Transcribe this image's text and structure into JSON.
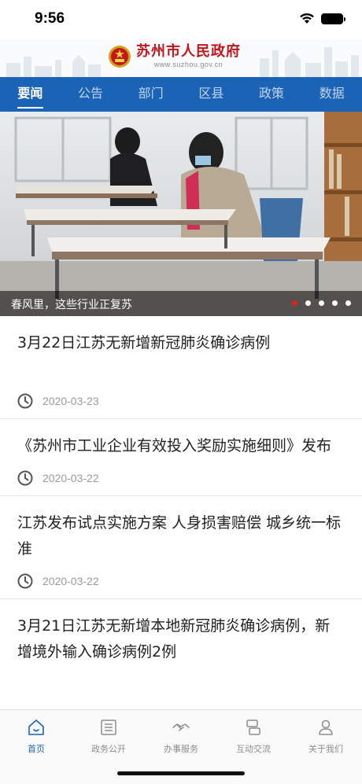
{
  "status_bar": {
    "time": "9:56",
    "icons": [
      "wifi-icon",
      "battery-icon"
    ]
  },
  "header": {
    "title": "苏州市人民政府",
    "url": "www.suzhou.gov.cn",
    "emblem": "national-emblem-icon"
  },
  "tabs": [
    {
      "label": "要闻",
      "active": true
    },
    {
      "label": "公告",
      "active": false
    },
    {
      "label": "部门",
      "active": false
    },
    {
      "label": "区县",
      "active": false
    },
    {
      "label": "政策",
      "active": false
    },
    {
      "label": "数据",
      "active": false
    }
  ],
  "banner": {
    "caption": "春风里，这些行业正复苏",
    "slide_count": 5,
    "active_slide": 1
  },
  "news": [
    {
      "title": "3月22日江苏无新增新冠肺炎确诊病例",
      "date": "2020-03-23"
    },
    {
      "title": "《苏州市工业企业有效投入奖励实施细则》发布",
      "date": "2020-03-22"
    },
    {
      "title": "江苏发布试点实施方案 人身损害赔偿 城乡统一标准",
      "date": "2020-03-22"
    },
    {
      "title": "3月21日江苏无新增本地新冠肺炎确诊病例，新增境外输入确诊病例2例",
      "date": ""
    }
  ],
  "bottom_nav": [
    {
      "label": "首页",
      "icon": "home-icon",
      "active": true
    },
    {
      "label": "政务公开",
      "icon": "document-list-icon",
      "active": false
    },
    {
      "label": "办事服务",
      "icon": "handshake-icon",
      "active": false
    },
    {
      "label": "互动交流",
      "icon": "exchange-icon",
      "active": false
    },
    {
      "label": "关于我们",
      "icon": "user-icon",
      "active": false
    }
  ],
  "colors": {
    "brand_red": "#c0161c",
    "tab_blue": "#1b63b6",
    "active_dot": "#e0201f"
  }
}
